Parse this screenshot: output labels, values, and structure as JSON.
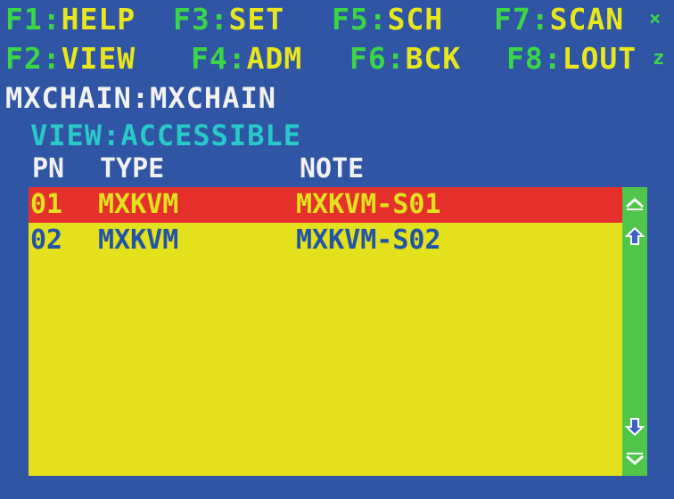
{
  "hotkeys": {
    "row1": [
      {
        "key": "F1",
        "label": "HELP"
      },
      {
        "key": "F3",
        "label": "SET"
      },
      {
        "key": "F5",
        "label": "SCH"
      },
      {
        "key": "F7",
        "label": "SCAN"
      }
    ],
    "row2": [
      {
        "key": "F2",
        "label": "VIEW"
      },
      {
        "key": "F4",
        "label": "ADM"
      },
      {
        "key": "F6",
        "label": "BCK"
      },
      {
        "key": "F8",
        "label": "LOUT"
      }
    ],
    "separator": ":"
  },
  "corner_icons": {
    "close": "×",
    "sleep": "z"
  },
  "title": "MXCHAIN:MXCHAIN",
  "view_mode": "VIEW:ACCESSIBLE",
  "columns": {
    "pn": "PN",
    "type": "TYPE",
    "note": "NOTE"
  },
  "rows": [
    {
      "pn": "01",
      "type": "MXKVM",
      "note": "MXKVM-S01",
      "selected": true
    },
    {
      "pn": "02",
      "type": "MXKVM",
      "note": "MXKVM-S02",
      "selected": false
    }
  ],
  "scrollbar": {
    "icons": [
      "chevron-up-icon",
      "arrow-up-icon",
      "arrow-down-icon",
      "chevron-down-icon"
    ]
  },
  "colors": {
    "background": "#2f55a4",
    "hotkey_key": "#3ad648",
    "hotkey_label": "#e8e61c",
    "list_background": "#e3e01c",
    "selected_row": "#e5302b",
    "row_text": "#2254a6",
    "scrollbar": "#4fc64a"
  }
}
